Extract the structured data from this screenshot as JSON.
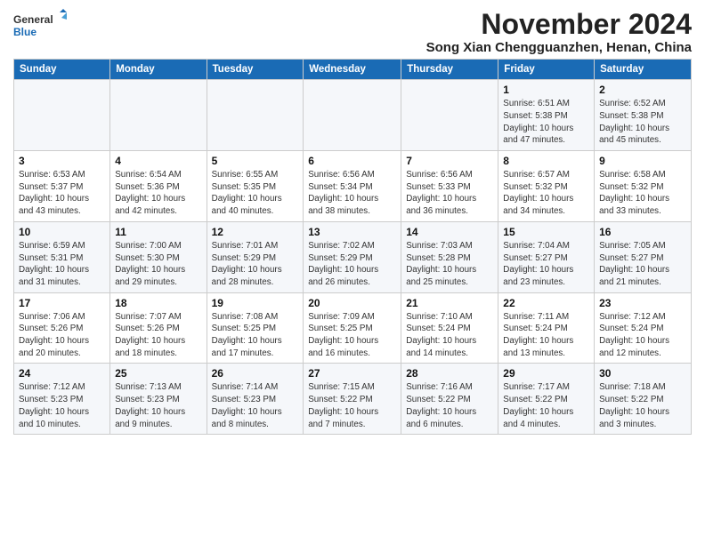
{
  "header": {
    "logo_line1": "General",
    "logo_line2": "Blue",
    "month_title": "November 2024",
    "subtitle": "Song Xian Chengguanzhen, Henan, China"
  },
  "weekdays": [
    "Sunday",
    "Monday",
    "Tuesday",
    "Wednesday",
    "Thursday",
    "Friday",
    "Saturday"
  ],
  "weeks": [
    [
      {
        "day": "",
        "info": ""
      },
      {
        "day": "",
        "info": ""
      },
      {
        "day": "",
        "info": ""
      },
      {
        "day": "",
        "info": ""
      },
      {
        "day": "",
        "info": ""
      },
      {
        "day": "1",
        "info": "Sunrise: 6:51 AM\nSunset: 5:38 PM\nDaylight: 10 hours\nand 47 minutes."
      },
      {
        "day": "2",
        "info": "Sunrise: 6:52 AM\nSunset: 5:38 PM\nDaylight: 10 hours\nand 45 minutes."
      }
    ],
    [
      {
        "day": "3",
        "info": "Sunrise: 6:53 AM\nSunset: 5:37 PM\nDaylight: 10 hours\nand 43 minutes."
      },
      {
        "day": "4",
        "info": "Sunrise: 6:54 AM\nSunset: 5:36 PM\nDaylight: 10 hours\nand 42 minutes."
      },
      {
        "day": "5",
        "info": "Sunrise: 6:55 AM\nSunset: 5:35 PM\nDaylight: 10 hours\nand 40 minutes."
      },
      {
        "day": "6",
        "info": "Sunrise: 6:56 AM\nSunset: 5:34 PM\nDaylight: 10 hours\nand 38 minutes."
      },
      {
        "day": "7",
        "info": "Sunrise: 6:56 AM\nSunset: 5:33 PM\nDaylight: 10 hours\nand 36 minutes."
      },
      {
        "day": "8",
        "info": "Sunrise: 6:57 AM\nSunset: 5:32 PM\nDaylight: 10 hours\nand 34 minutes."
      },
      {
        "day": "9",
        "info": "Sunrise: 6:58 AM\nSunset: 5:32 PM\nDaylight: 10 hours\nand 33 minutes."
      }
    ],
    [
      {
        "day": "10",
        "info": "Sunrise: 6:59 AM\nSunset: 5:31 PM\nDaylight: 10 hours\nand 31 minutes."
      },
      {
        "day": "11",
        "info": "Sunrise: 7:00 AM\nSunset: 5:30 PM\nDaylight: 10 hours\nand 29 minutes."
      },
      {
        "day": "12",
        "info": "Sunrise: 7:01 AM\nSunset: 5:29 PM\nDaylight: 10 hours\nand 28 minutes."
      },
      {
        "day": "13",
        "info": "Sunrise: 7:02 AM\nSunset: 5:29 PM\nDaylight: 10 hours\nand 26 minutes."
      },
      {
        "day": "14",
        "info": "Sunrise: 7:03 AM\nSunset: 5:28 PM\nDaylight: 10 hours\nand 25 minutes."
      },
      {
        "day": "15",
        "info": "Sunrise: 7:04 AM\nSunset: 5:27 PM\nDaylight: 10 hours\nand 23 minutes."
      },
      {
        "day": "16",
        "info": "Sunrise: 7:05 AM\nSunset: 5:27 PM\nDaylight: 10 hours\nand 21 minutes."
      }
    ],
    [
      {
        "day": "17",
        "info": "Sunrise: 7:06 AM\nSunset: 5:26 PM\nDaylight: 10 hours\nand 20 minutes."
      },
      {
        "day": "18",
        "info": "Sunrise: 7:07 AM\nSunset: 5:26 PM\nDaylight: 10 hours\nand 18 minutes."
      },
      {
        "day": "19",
        "info": "Sunrise: 7:08 AM\nSunset: 5:25 PM\nDaylight: 10 hours\nand 17 minutes."
      },
      {
        "day": "20",
        "info": "Sunrise: 7:09 AM\nSunset: 5:25 PM\nDaylight: 10 hours\nand 16 minutes."
      },
      {
        "day": "21",
        "info": "Sunrise: 7:10 AM\nSunset: 5:24 PM\nDaylight: 10 hours\nand 14 minutes."
      },
      {
        "day": "22",
        "info": "Sunrise: 7:11 AM\nSunset: 5:24 PM\nDaylight: 10 hours\nand 13 minutes."
      },
      {
        "day": "23",
        "info": "Sunrise: 7:12 AM\nSunset: 5:24 PM\nDaylight: 10 hours\nand 12 minutes."
      }
    ],
    [
      {
        "day": "24",
        "info": "Sunrise: 7:12 AM\nSunset: 5:23 PM\nDaylight: 10 hours\nand 10 minutes."
      },
      {
        "day": "25",
        "info": "Sunrise: 7:13 AM\nSunset: 5:23 PM\nDaylight: 10 hours\nand 9 minutes."
      },
      {
        "day": "26",
        "info": "Sunrise: 7:14 AM\nSunset: 5:23 PM\nDaylight: 10 hours\nand 8 minutes."
      },
      {
        "day": "27",
        "info": "Sunrise: 7:15 AM\nSunset: 5:22 PM\nDaylight: 10 hours\nand 7 minutes."
      },
      {
        "day": "28",
        "info": "Sunrise: 7:16 AM\nSunset: 5:22 PM\nDaylight: 10 hours\nand 6 minutes."
      },
      {
        "day": "29",
        "info": "Sunrise: 7:17 AM\nSunset: 5:22 PM\nDaylight: 10 hours\nand 4 minutes."
      },
      {
        "day": "30",
        "info": "Sunrise: 7:18 AM\nSunset: 5:22 PM\nDaylight: 10 hours\nand 3 minutes."
      }
    ]
  ]
}
